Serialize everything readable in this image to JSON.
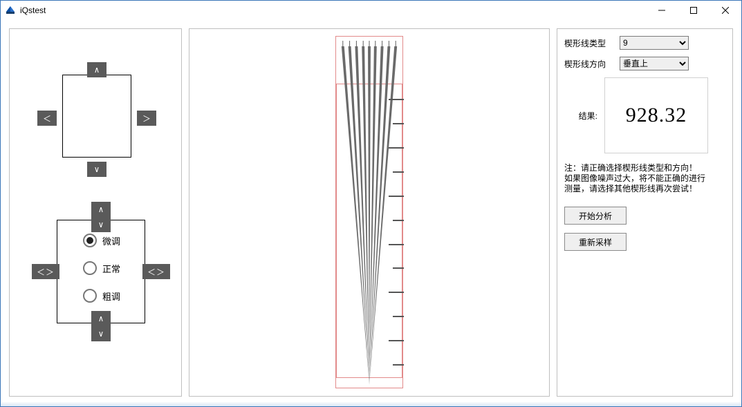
{
  "window": {
    "title": "iQstest"
  },
  "nav": {
    "up": "∧",
    "down": "∨",
    "left": "＜",
    "right": "＞",
    "dbl_up": "∧",
    "dbl_down": "∨",
    "dbl_left": "＜＞",
    "dbl_right": "＜＞",
    "inner_up": "∨",
    "inner_down": "∧"
  },
  "tune": {
    "options": [
      {
        "key": "fine",
        "label": "微调",
        "selected": true
      },
      {
        "key": "normal",
        "label": "正常",
        "selected": false
      },
      {
        "key": "coarse",
        "label": "粗调",
        "selected": false
      }
    ]
  },
  "settings": {
    "type_label": "楔形线类型",
    "type_value": "9",
    "dir_label": "楔形线方向",
    "dir_value": "垂直上"
  },
  "result": {
    "label": "结果:",
    "value": "928.32"
  },
  "note": {
    "line1": "注：请正确选择楔形线类型和方向！",
    "line2": "如果图像噪声过大，将不能正确的进行",
    "line3": "测量，请选择其他楔形线再次尝试！"
  },
  "buttons": {
    "analyze": "开始分析",
    "resample": "重新采样"
  }
}
